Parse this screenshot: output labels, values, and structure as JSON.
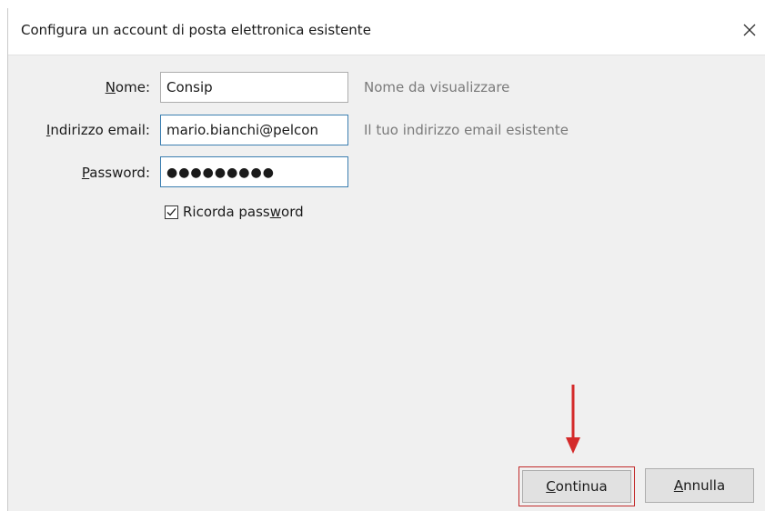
{
  "dialog": {
    "title": "Configura un account di posta elettronica esistente"
  },
  "form": {
    "name_label": "Nome:",
    "name_value": "Consip",
    "name_hint": "Nome da visualizzare",
    "email_label": "Indirizzo email:",
    "email_value": "mario.bianchi@pelcon",
    "email_hint": "Il tuo indirizzo email esistente",
    "password_label": "Password:",
    "password_mask": "●●●●●●●●●",
    "remember_label": "Ricorda password",
    "remember_checked": true
  },
  "buttons": {
    "continue_label": "Continua",
    "cancel_label": "Annulla"
  },
  "icons": {
    "close": "close-icon",
    "checkmark": "checkmark-icon",
    "annotation_arrow": "red-arrow-down-icon"
  },
  "colors": {
    "accent_focus": "#3c7fb1",
    "annotation_red": "#d42a2a",
    "hint_gray": "#7a7a7a",
    "dialog_bg": "#f0f0f0"
  }
}
